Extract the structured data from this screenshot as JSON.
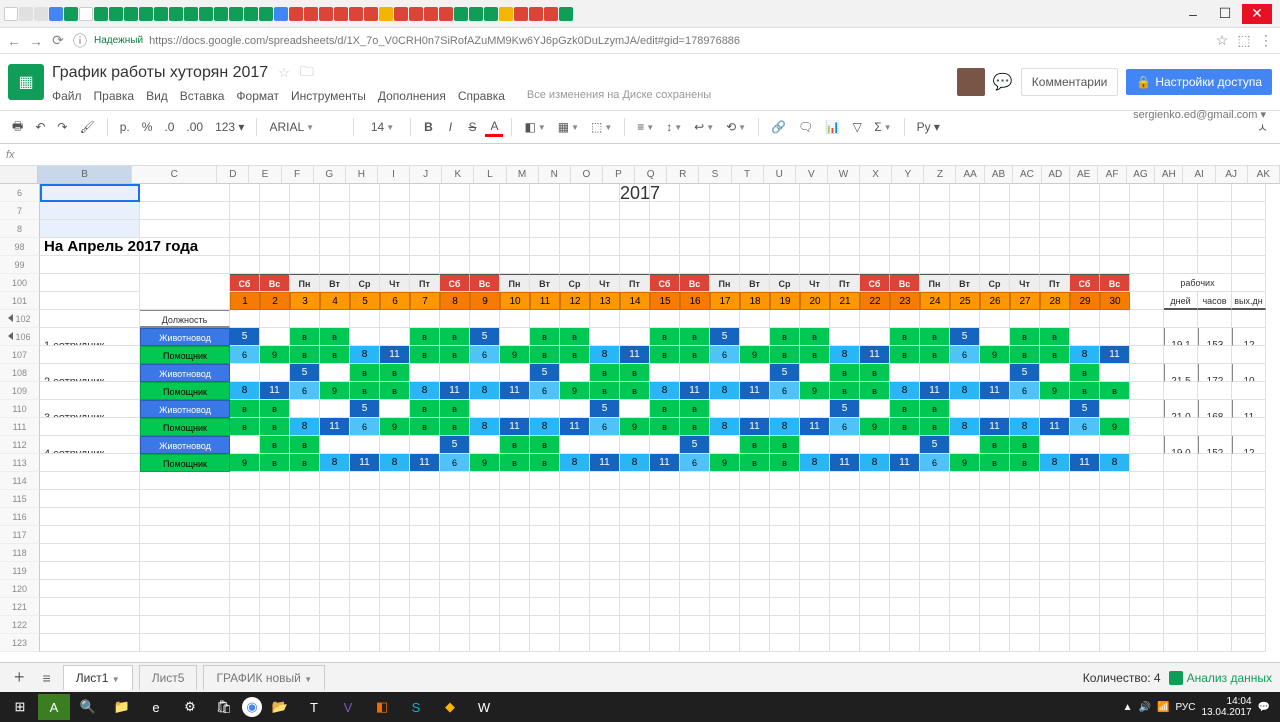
{
  "browser": {
    "win": [
      "–",
      "☐",
      "✕"
    ],
    "url": "https://docs.google.com/spreadsheets/d/1X_7o_V0CRH0n7SiRofAZuMM9Kw6YJ6pGzk0DuLzymJA/edit#gid=178976886",
    "secure": "Надежный"
  },
  "app": {
    "title": "График работы хуторян 2017",
    "email": "sergienko.ed@gmail.com ▾",
    "comments": "Комментарии",
    "share": "Настройки доступа",
    "saved": "Все изменения на Диске сохранены"
  },
  "menu": [
    "Файл",
    "Правка",
    "Вид",
    "Вставка",
    "Формат",
    "Инструменты",
    "Дополнения",
    "Справка"
  ],
  "toolbar": {
    "font": "ARIAL",
    "size": "14",
    "curr": "р.",
    "pct": "%",
    "dec0": ".0",
    "dec00": ".00",
    "fmt": "123 ▾",
    "more": "Ру ▾"
  },
  "fx": "fx",
  "cols": [
    "B",
    "C",
    "D",
    "E",
    "F",
    "G",
    "H",
    "I",
    "J",
    "K",
    "L",
    "M",
    "N",
    "O",
    "P",
    "Q",
    "R",
    "S",
    "T",
    "U",
    "V",
    "W",
    "X",
    "Y",
    "Z",
    "AA",
    "AB",
    "AC",
    "AD",
    "AE",
    "AF",
    "AG",
    "AH",
    "AI",
    "AJ",
    "AK"
  ],
  "rows": [
    "6",
    "7",
    "8",
    "98",
    "99",
    "100",
    "101",
    "102",
    "106",
    "107",
    "108",
    "109",
    "110",
    "111",
    "112",
    "113",
    "114",
    "115",
    "116",
    "117",
    "118",
    "119",
    "120",
    "121",
    "122",
    "123"
  ],
  "content": {
    "year": "2017",
    "heading": "На Апрель 2017 года",
    "pos_hdr": "Должность",
    "jobs": [
      "Животновод",
      "Помощник"
    ],
    "emp": [
      "1 сотрудник",
      "2 сотрудник",
      "3 сотрудник",
      "4 сотрудник"
    ],
    "sum_hdr": [
      "рабочих",
      "дней",
      "часов",
      "вых.дн"
    ],
    "dow": [
      "Сб",
      "Вс",
      "Пн",
      "Вт",
      "Ср",
      "Чт",
      "Пт",
      "Сб",
      "Вс",
      "Пн",
      "Вт",
      "Ср",
      "Чт",
      "Пт",
      "Сб",
      "Вс",
      "Пн",
      "Вт",
      "Ср",
      "Чт",
      "Пт",
      "Сб",
      "Вс",
      "Пн",
      "Вт",
      "Ср",
      "Чт",
      "Пт",
      "Сб",
      "Вс"
    ],
    "dnum": [
      "1",
      "2",
      "3",
      "4",
      "5",
      "6",
      "7",
      "8",
      "9",
      "10",
      "11",
      "12",
      "13",
      "14",
      "15",
      "16",
      "17",
      "18",
      "19",
      "20",
      "21",
      "22",
      "23",
      "24",
      "25",
      "26",
      "27",
      "28",
      "29",
      "30"
    ],
    "e1": {
      "a": [
        "5",
        "",
        "в",
        "в",
        "",
        "",
        "в",
        "в",
        "5",
        "",
        "в",
        "в",
        "",
        "",
        "в",
        "в",
        "5",
        "",
        "в",
        "в",
        "",
        "",
        "в",
        "в",
        "5",
        "",
        "в",
        "в",
        "",
        ""
      ],
      "b": [
        "6",
        "9",
        "в",
        "в",
        "8",
        "11",
        "в",
        "в",
        "6",
        "9",
        "в",
        "в",
        "8",
        "11",
        "в",
        "в",
        "6",
        "9",
        "в",
        "в",
        "8",
        "11",
        "в",
        "в",
        "6",
        "9",
        "в",
        "в",
        "8",
        "11"
      ],
      "s": [
        "19,1",
        "153",
        "12"
      ]
    },
    "e2": {
      "a": [
        "",
        "",
        "5",
        "",
        "в",
        "в",
        "",
        "",
        "",
        "",
        "5",
        "",
        "в",
        "в",
        "",
        "",
        "",
        "",
        "5",
        "",
        "в",
        "в",
        "",
        "",
        "",
        "",
        "5",
        "",
        "в",
        ""
      ],
      "b": [
        "8",
        "11",
        "6",
        "9",
        "в",
        "в",
        "8",
        "11",
        "8",
        "11",
        "6",
        "9",
        "в",
        "в",
        "8",
        "11",
        "8",
        "11",
        "6",
        "9",
        "в",
        "в",
        "8",
        "11",
        "8",
        "11",
        "6",
        "9",
        "в",
        "в"
      ],
      "s": [
        "21,5",
        "172",
        "10"
      ]
    },
    "e3": {
      "a": [
        "в",
        "в",
        "",
        "",
        "5",
        "",
        "в",
        "в",
        "",
        "",
        "",
        "",
        "5",
        "",
        "в",
        "в",
        "",
        "",
        "",
        "",
        "5",
        "",
        "в",
        "в",
        "",
        "",
        "",
        "",
        "5",
        ""
      ],
      "b": [
        "в",
        "в",
        "8",
        "11",
        "6",
        "9",
        "в",
        "в",
        "8",
        "11",
        "8",
        "11",
        "6",
        "9",
        "в",
        "в",
        "8",
        "11",
        "8",
        "11",
        "6",
        "9",
        "в",
        "в",
        "8",
        "11",
        "8",
        "11",
        "6",
        "9"
      ],
      "s": [
        "21,0",
        "168",
        "11"
      ]
    },
    "e4": {
      "a": [
        "",
        "в",
        "в",
        "",
        "",
        "",
        "",
        "5",
        "",
        "в",
        "в",
        "",
        "",
        "",
        "",
        "5",
        "",
        "в",
        "в",
        "",
        "",
        "",
        "",
        "5",
        "",
        "в",
        "в",
        "",
        "",
        ""
      ],
      "b": [
        "9",
        "в",
        "в",
        "8",
        "11",
        "8",
        "11",
        "6",
        "9",
        "в",
        "в",
        "8",
        "11",
        "8",
        "11",
        "6",
        "9",
        "в",
        "в",
        "8",
        "11",
        "8",
        "11",
        "6",
        "9",
        "в",
        "в",
        "8",
        "11",
        "8"
      ],
      "s": [
        "19,0",
        "152",
        "12"
      ]
    }
  },
  "tabs": {
    "t": [
      "Лист1",
      "Лист5",
      "ГРАФИК новый"
    ],
    "count": "Количество: 4",
    "analyze": "Анализ данных"
  },
  "taskbar": {
    "time": "14:04",
    "date": "13.04.2017",
    "lang": "РУС"
  }
}
